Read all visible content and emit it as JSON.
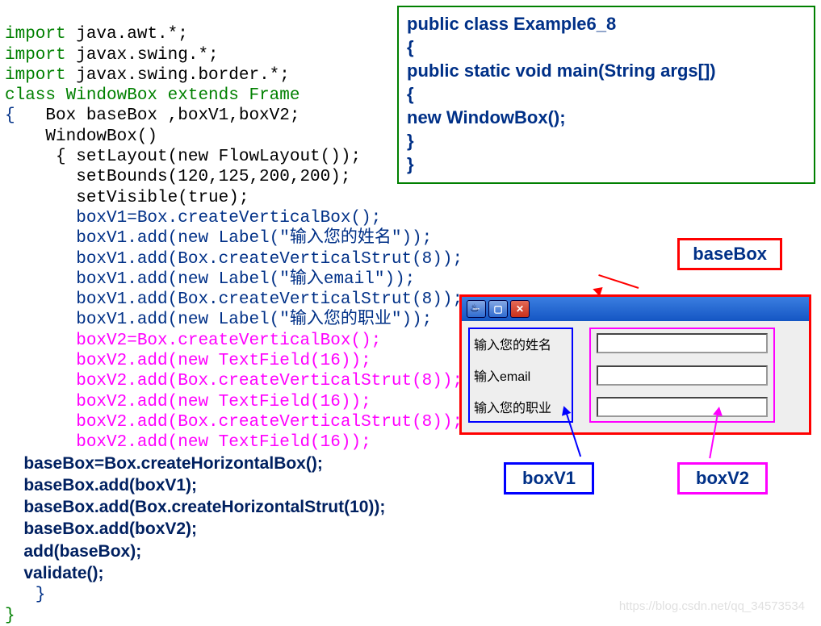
{
  "code_left": {
    "l1a": "import",
    "l1b": " java.awt.*;",
    "l2a": "import",
    "l2b": " javax.swing.*;",
    "l3a": "import",
    "l3b": " javax.swing.border.*;",
    "l4a": "class",
    "l4b": " WindowBox ",
    "l4c": "extends",
    "l4d": " Frame",
    "l5a": "{",
    "l5b": "   Box baseBox ,boxV1,boxV2;",
    "l6": "    WindowBox()",
    "l7": "     { setLayout(new FlowLayout());",
    "l8": "       setBounds(120,125,200,200);",
    "l9": "       setVisible(true);",
    "l10": "       boxV1=Box.createVerticalBox();",
    "l11": "       boxV1.add(new Label(\"输入您的姓名\"));",
    "l12": "       boxV1.add(Box.createVerticalStrut(8));",
    "l13": "       boxV1.add(new Label(\"输入email\"));",
    "l14": "       boxV1.add(Box.createVerticalStrut(8));",
    "l15": "       boxV1.add(new Label(\"输入您的职业\"));",
    "l16": "       boxV2=Box.createVerticalBox();",
    "l17": "       boxV2.add(new TextField(16));",
    "l18": "       boxV2.add(Box.createVerticalStrut(8));",
    "l19": "       boxV2.add(new TextField(16));",
    "l20": "       boxV2.add(Box.createVerticalStrut(8));",
    "l21": "       boxV2.add(new TextField(16));",
    "b1": "    baseBox=Box.createHorizontalBox();",
    "b2": "    baseBox.add(boxV1);",
    "b3": "    baseBox.add(Box.createHorizontalStrut(10));",
    "b4": "    baseBox.add(boxV2);",
    "b5": "    add(baseBox);",
    "b6": "    validate();",
    "close1": "   }",
    "close2": "}"
  },
  "code_right": {
    "l1": "public class Example6_8",
    "l2": "{",
    "l3": "   public static void main(String args[])",
    "l4": "   {",
    "l5": "    new WindowBox();",
    "l6": "   }",
    "l7": "}"
  },
  "diagram": {
    "basebox_label": "baseBox",
    "boxv1_label": "boxV1",
    "boxv2_label": "boxV2",
    "fields": {
      "name": "输入您的姓名",
      "email": "输入email",
      "job": "输入您的职业"
    },
    "java_icon": "♨"
  },
  "watermark": "https://blog.csdn.net/qq_34573534"
}
